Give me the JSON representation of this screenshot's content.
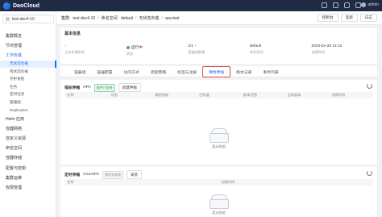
{
  "app": {
    "name": "DaoCloud"
  },
  "user": {
    "name": "admin"
  },
  "workspace": {
    "name": "test-dec4-10"
  },
  "sidebar": {
    "items": [
      {
        "label": "集群概览",
        "type": "item"
      },
      {
        "label": "节点管理",
        "type": "item"
      },
      {
        "label": "工作负载",
        "type": "parent"
      },
      {
        "label": "无状态负载",
        "type": "sub-active"
      },
      {
        "label": "有状态负载",
        "type": "sub"
      },
      {
        "label": "守护进程",
        "type": "sub"
      },
      {
        "label": "任务",
        "type": "sub"
      },
      {
        "label": "定时任务",
        "type": "sub"
      },
      {
        "label": "容器组",
        "type": "sub"
      },
      {
        "label": "ReplicaSet",
        "type": "sub"
      },
      {
        "label": "Helm 应用",
        "type": "item"
      },
      {
        "label": "容器网络",
        "type": "item"
      },
      {
        "label": "自定义资源",
        "type": "item"
      },
      {
        "label": "命名空间",
        "type": "item"
      },
      {
        "label": "容器存储",
        "type": "item"
      },
      {
        "label": "配置与密钥",
        "type": "item"
      },
      {
        "label": "集群运维",
        "type": "item"
      },
      {
        "label": "权限管理",
        "type": "item"
      }
    ]
  },
  "breadcrumb": {
    "cluster_label": "集群:",
    "cluster": "test-dec4-10",
    "namespace_label": "命名空间:",
    "namespace": "default",
    "section": "无状态负载",
    "current": "vpa-test"
  },
  "header_buttons": [
    "控制台",
    "监控",
    "日志"
  ],
  "basic_info": {
    "title": "基本信息",
    "fields": [
      {
        "value": "-",
        "label": "工作负载别名"
      },
      {
        "value": "运行中",
        "label": "状态",
        "status": true
      },
      {
        "value": "1/1 ↑",
        "label": "容器组数量"
      },
      {
        "value": "default",
        "label": "命名空间"
      },
      {
        "value": "2023-02-20 13:12",
        "label": "创建时间"
      }
    ]
  },
  "tabs": [
    "容器组",
    "容器配置",
    "访问方式",
    "调度策略",
    "标签与注解",
    "弹性伸缩",
    "版本记录",
    "事件列表"
  ],
  "active_tab": "弹性伸缩",
  "hpa_panel": {
    "title": "指标伸缩",
    "kind": "HPA",
    "tag": "插件已安装",
    "create_button": "新建伸缩",
    "columns": [
      "名称",
      "状态",
      "触发指标",
      "目标值",
      "副本范围",
      "当前副本",
      "创建时间"
    ],
    "empty_text": "暂无数据"
  },
  "cron_panel": {
    "title": "定时伸缩",
    "kind": "CronHPA",
    "tag": "插件未安装",
    "install_button": "安装",
    "columns": [
      "名称",
      "创建时间"
    ],
    "empty_text": "暂无数据"
  }
}
